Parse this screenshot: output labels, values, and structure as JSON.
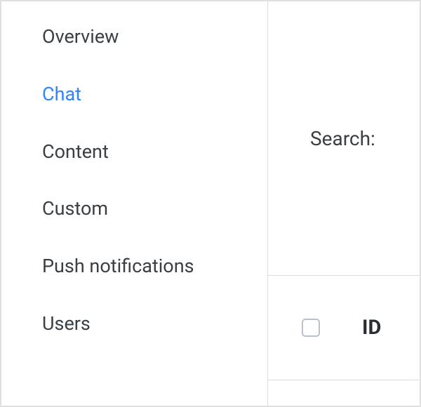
{
  "sidebar": {
    "items": [
      {
        "label": "Overview",
        "active": false
      },
      {
        "label": "Chat",
        "active": true
      },
      {
        "label": "Content",
        "active": false
      },
      {
        "label": "Custom",
        "active": false
      },
      {
        "label": "Push notifications",
        "active": false
      },
      {
        "label": "Users",
        "active": false
      }
    ]
  },
  "main": {
    "search_label": "Search:",
    "table": {
      "columns": [
        {
          "header": "ID"
        }
      ]
    }
  }
}
